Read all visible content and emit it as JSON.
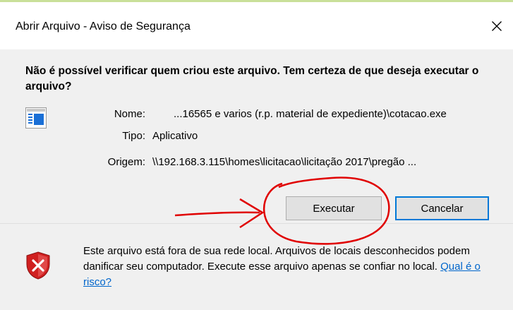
{
  "window": {
    "title": "Abrir Arquivo - Aviso de Segurança",
    "close_glyph": "✕"
  },
  "dialog": {
    "question": "Não é possível verificar quem criou este arquivo. Tem certeza de que deseja executar o arquivo?",
    "file_icon": "application-icon",
    "fields": {
      "name_label": "Nome:",
      "name_value": "...16565 e varios (r.p. material de expediente)\\cotacao.exe",
      "type_label": "Tipo:",
      "type_value": "Aplicativo",
      "origin_label": "Origem:",
      "origin_value": "\\\\192.168.3.115\\homes\\licitacao\\licitação 2017\\pregão ..."
    },
    "buttons": {
      "run_label": "Executar",
      "cancel_label": "Cancelar"
    }
  },
  "warning": {
    "icon": "shield-error-icon",
    "text": "Este arquivo está fora de sua rede local. Arquivos de locais desconhecidos podem danificar seu computador. Execute esse arquivo apenas se confiar no local.",
    "link_label": "Qual é o risco?"
  },
  "colors": {
    "accent_border": "#0078d7",
    "link": "#0066cc",
    "annotation": "#e00000",
    "shield": "#d02020"
  }
}
